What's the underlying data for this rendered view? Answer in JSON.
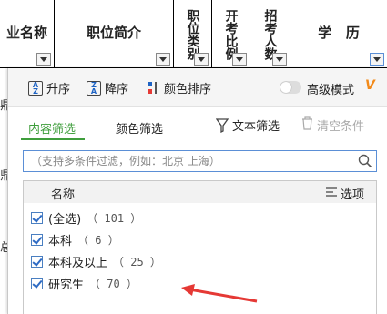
{
  "sheet": {
    "columns": [
      {
        "label": "名称",
        "prefix": "业"
      },
      {
        "label": "职位简介"
      },
      {
        "label": "职位类别"
      },
      {
        "label": "开考比例"
      },
      {
        "label": "招考人数"
      },
      {
        "label": "学   历"
      }
    ],
    "left_fragments": [
      "鼎",
      "鼎",
      "总"
    ]
  },
  "sort_bar": {
    "asc_label": "升序",
    "desc_label": "降序",
    "color_sort_label": "颜色排序",
    "advanced_mode_label": "高级模式"
  },
  "tabs": {
    "content_filter": "内容筛选",
    "color_filter": "颜色筛选",
    "text_filter": "文本筛选",
    "clear": "清空条件"
  },
  "search": {
    "placeholder": "（支持多条件过滤，例如：北京  上海）"
  },
  "list": {
    "name_header": "名称",
    "options_label": "选项",
    "items": [
      {
        "label": "(全选)",
        "count": "（ 101 ）"
      },
      {
        "label": "本科",
        "count": "（ 6 ）"
      },
      {
        "label": "本科及以上",
        "count": "（ 25 ）"
      },
      {
        "label": "研究生",
        "count": "（ 70 ）"
      }
    ]
  },
  "colors": {
    "accent": "#3f9e3c",
    "arrow": "#e53935",
    "check": "#2e6bc4"
  }
}
